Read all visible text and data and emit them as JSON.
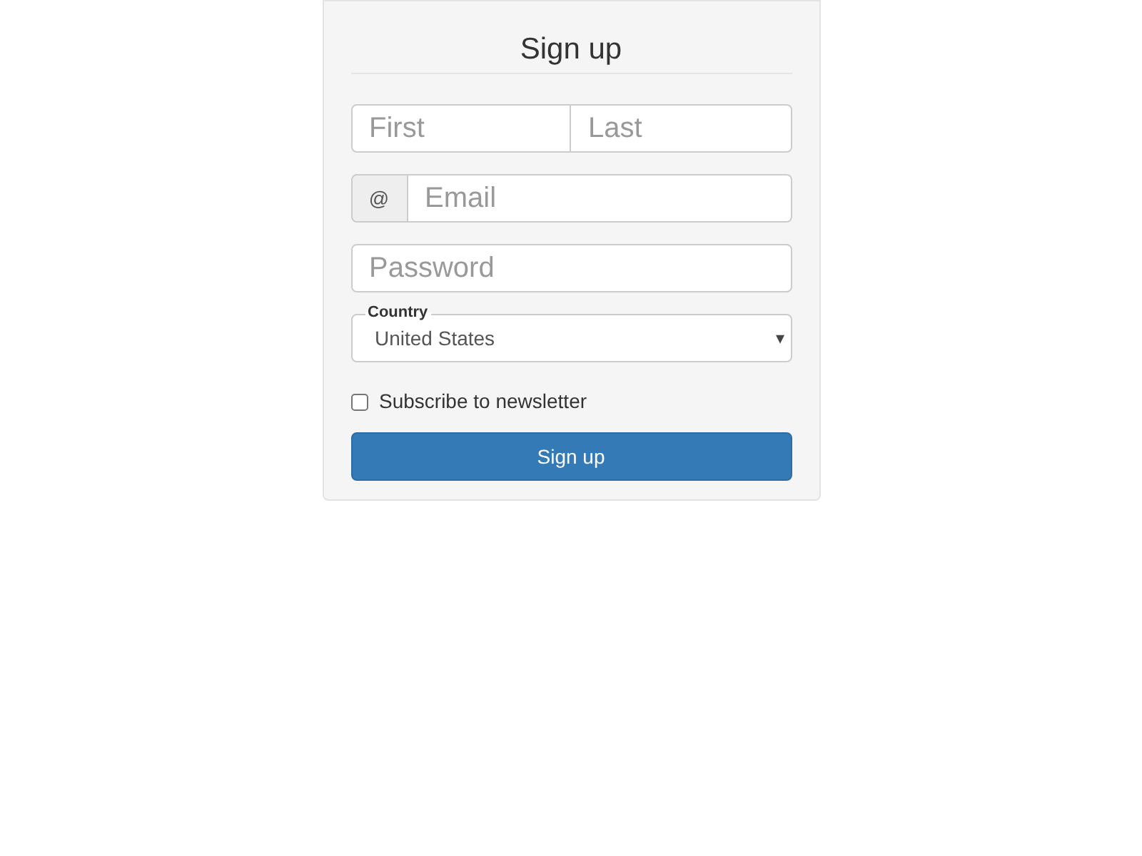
{
  "form": {
    "title": "Sign up",
    "name": {
      "first_placeholder": "First",
      "last_placeholder": "Last"
    },
    "email": {
      "addon": "@",
      "placeholder": "Email"
    },
    "password": {
      "placeholder": "Password"
    },
    "country": {
      "label": "Country",
      "value": "United States",
      "caret": "▾"
    },
    "newsletter": {
      "label": "Subscribe to newsletter",
      "checked": false
    },
    "submit": "Sign up"
  }
}
